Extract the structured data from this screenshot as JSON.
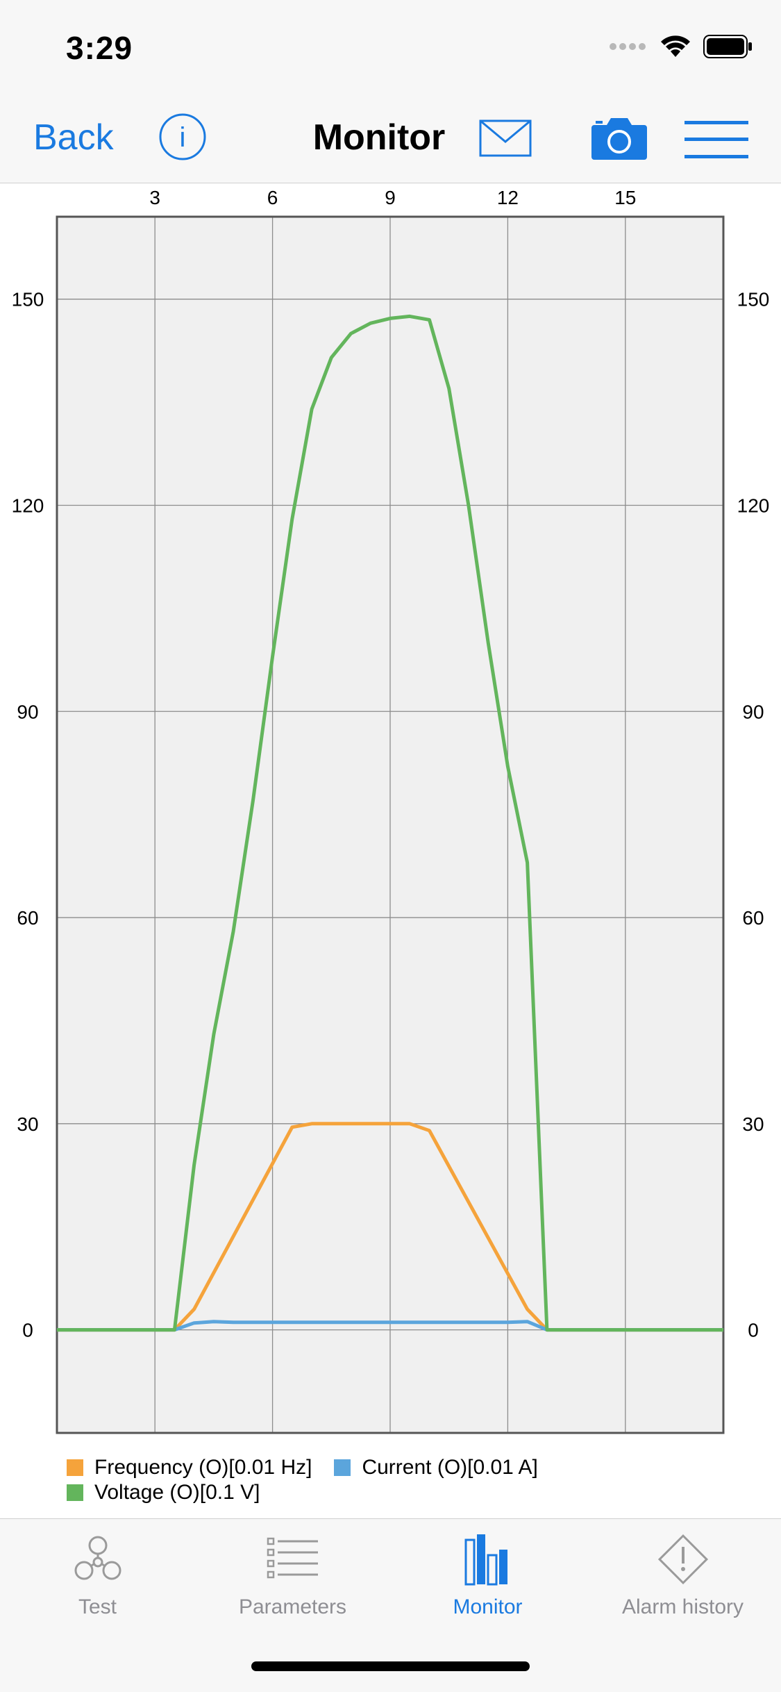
{
  "status_bar": {
    "time": "3:29"
  },
  "nav": {
    "back_label": "Back",
    "title": "Monitor",
    "icons": [
      "info-icon",
      "mail-icon",
      "camera-icon",
      "menu-icon"
    ]
  },
  "colors": {
    "accent": "#1a7ae0",
    "frequency": "#f5a33b",
    "current": "#5ba5dc",
    "voltage": "#63b55c",
    "plot_bg": "#f0f0f0",
    "grid": "#8c8c8c"
  },
  "chart_data": {
    "type": "line",
    "title": "",
    "xlabel": "",
    "ylabel": "",
    "xlim": [
      0.5,
      17.5
    ],
    "ylim": [
      -15,
      162
    ],
    "x_ticks": [
      3,
      6,
      9,
      12,
      15
    ],
    "y_ticks": [
      0,
      30,
      60,
      90,
      120,
      150
    ],
    "y_ticks_right": [
      0,
      30,
      60,
      90,
      120,
      150
    ],
    "grid": true,
    "legend_position": "bottom-left",
    "series": [
      {
        "name": "Frequency (O)[0.01 Hz]",
        "color": "#f5a33b",
        "x": [
          0.5,
          3.5,
          4.0,
          6.5,
          7.0,
          9.5,
          10.0,
          12.5,
          13.0,
          17.5
        ],
        "y": [
          0,
          0,
          3,
          29.5,
          30,
          30,
          29,
          3,
          0,
          0
        ]
      },
      {
        "name": "Current (O)[0.01 A]",
        "color": "#5ba5dc",
        "x": [
          0.5,
          3.5,
          4.0,
          4.5,
          5.0,
          6.0,
          8.0,
          10.0,
          12.0,
          12.5,
          13.0,
          17.5
        ],
        "y": [
          0,
          0,
          1,
          1.2,
          1.1,
          1.1,
          1.1,
          1.1,
          1.1,
          1.2,
          0,
          0
        ]
      },
      {
        "name": "Voltage (O)[0.1 V]",
        "color": "#63b55c",
        "x": [
          0.5,
          3.5,
          4.0,
          4.5,
          5.0,
          5.5,
          6.0,
          6.5,
          7.0,
          7.5,
          8.0,
          8.5,
          9.0,
          9.5,
          10.0,
          10.5,
          11.0,
          11.5,
          12.0,
          12.5,
          13.0,
          17.5
        ],
        "y": [
          0,
          0,
          24,
          43,
          58,
          77,
          98,
          118,
          134,
          141.5,
          145,
          146.5,
          147.2,
          147.5,
          147,
          137,
          120,
          100,
          82,
          68,
          0,
          0
        ]
      }
    ]
  },
  "legend": {
    "row1": [
      "Frequency (O)[0.01 Hz]",
      "Current (O)[0.01 A]"
    ],
    "row2": [
      "Voltage (O)[0.1 V]"
    ]
  },
  "tabs": [
    {
      "label": "Test",
      "icon": "fan-icon",
      "active": false
    },
    {
      "label": "Parameters",
      "icon": "list-icon",
      "active": false
    },
    {
      "label": "Monitor",
      "icon": "bar-chart-icon",
      "active": true
    },
    {
      "label": "Alarm history",
      "icon": "alert-icon",
      "active": false
    }
  ]
}
